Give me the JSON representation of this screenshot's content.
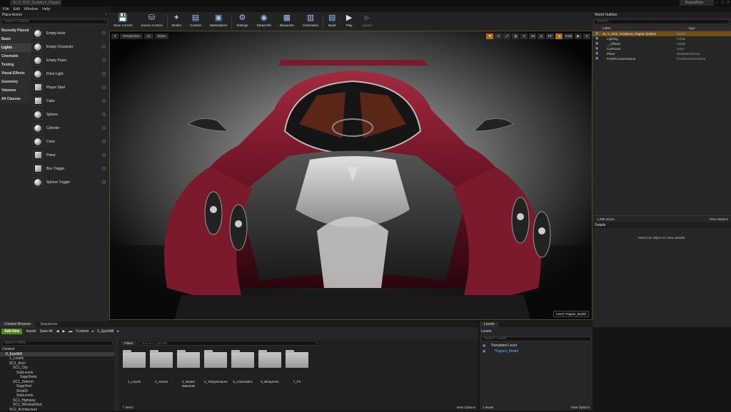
{
  "window": {
    "doc_tab": "SI_V_SO2_Sculpture_Pagani",
    "brand": "BrandFilm"
  },
  "menu": [
    "File",
    "Edit",
    "Window",
    "Help"
  ],
  "place_actors": {
    "title": "Place Actors",
    "search_placeholder": "Search Classes",
    "categories": [
      "Recently Placed",
      "Basic",
      "Lights",
      "Cinematic",
      "Testing",
      "Visual Effects",
      "Geometry",
      "Volumes",
      "All Classes"
    ],
    "selected_category": "Lights",
    "items": [
      "Empty Actor",
      "Empty Character",
      "Empty Pawn",
      "Point Light",
      "Player Start",
      "Cube",
      "Sphere",
      "Cylinder",
      "Cone",
      "Plane",
      "Box Trigger",
      "Sphere Trigger"
    ]
  },
  "toolbar": [
    {
      "label": "Save Current",
      "icon": "save-icon"
    },
    {
      "label": "Source Control",
      "icon": "source-control-icon"
    },
    {
      "label": "Modes",
      "icon": "modes-icon"
    },
    {
      "label": "Content",
      "icon": "content-icon"
    },
    {
      "label": "Marketplace",
      "icon": "marketplace-icon"
    },
    {
      "label": "Settings",
      "icon": "settings-icon"
    },
    {
      "label": "Datasmith",
      "icon": "datasmith-icon"
    },
    {
      "label": "Blueprints",
      "icon": "blueprints-icon"
    },
    {
      "label": "Cinematics",
      "icon": "cinematics-icon"
    },
    {
      "label": "Build",
      "icon": "build-icon"
    },
    {
      "label": "Play",
      "icon": "play-icon"
    },
    {
      "label": "Launch",
      "icon": "launch-icon"
    }
  ],
  "viewport": {
    "perspective": "Perspective",
    "lit": "Lit",
    "show": "Show",
    "right_values": [
      "10",
      "10°",
      "0.25",
      "2"
    ],
    "level_label": "Level:  Pagani_Model"
  },
  "world_outliner": {
    "title": "World Outliner",
    "search_placeholder": "Search...",
    "col_label": "Label",
    "col_type": "Type",
    "rows": [
      {
        "name": "SI_V_SO2_Sculpture_Pagani (Editor)",
        "type": "World",
        "indent": 0,
        "selected": true
      },
      {
        "name": "Lighting",
        "type": "Folder",
        "indent": 1,
        "selected": false
      },
      {
        "name": "__Offsets",
        "type": "Folder",
        "indent": 1,
        "selected": false
      },
      {
        "name": "CarRoot2",
        "type": "Actor",
        "indent": 1,
        "selected": false
      },
      {
        "name": "Plane",
        "type": "StaticMeshActor",
        "indent": 1,
        "selected": false
      },
      {
        "name": "PostProcessVolume",
        "type": "PostProcessVolume",
        "indent": 1,
        "selected": false
      }
    ],
    "actor_count": "1,098 actors",
    "view_options": "View Options"
  },
  "details": {
    "title": "Details",
    "message": "Select an object to view details."
  },
  "content_browser": {
    "tabs": [
      "Content Browser",
      "Sequencer"
    ],
    "add_new": "Add New",
    "import": "Import",
    "save_all": "Save All",
    "path": [
      "Content",
      "0_EpicMill"
    ],
    "search_paths": "Search Paths",
    "filters": "Filters",
    "search_placeholder": "Search 0_EpicMill",
    "tree": [
      "Content",
      "0_EpicMill",
      "1_Levels",
      "SC1_Arch",
      "SC1_City",
      "SubLevels",
      "SagaTests",
      "SC1_Deform",
      "SagaTest",
      "Shot09",
      "SubLevels",
      "SC1_Highway",
      "SC1_WindowShot",
      "SC2_Architecture"
    ],
    "folders": [
      "1_Levels",
      "2_Assets",
      "3_Master Materials",
      "4_TilingTextures",
      "5_Cinematics",
      "6_BlueprInts",
      "7_FX"
    ],
    "item_count": "7 items",
    "view_options": "View Options"
  },
  "levels": {
    "tab": "Levels",
    "menu": "Levels",
    "search_placeholder": "Search Levels",
    "rows": [
      "Persistent Level",
      "*Pagani_Model"
    ],
    "count": "2 levels",
    "view_options": "View Options"
  },
  "colors": {
    "accent_orange": "#b8680f",
    "add_new_green": "#4e8a1e",
    "selection": "#6f4e17",
    "car_red": "#7a1a2a"
  }
}
